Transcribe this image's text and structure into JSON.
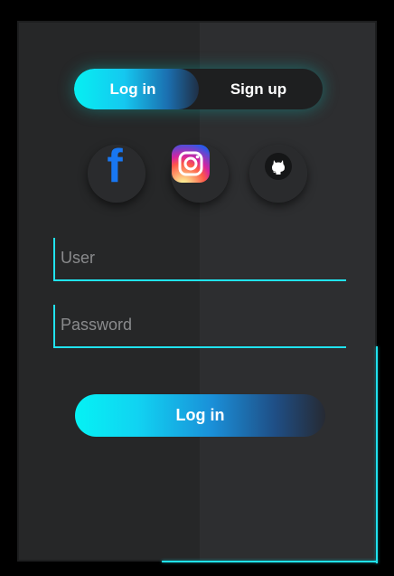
{
  "toggle": {
    "login_label": "Log in",
    "signup_label": "Sign up",
    "active": "login"
  },
  "social": [
    {
      "name": "facebook",
      "icon": "facebook-icon",
      "glyph": "f",
      "color": "#1877f2"
    },
    {
      "name": "instagram",
      "icon": "instagram-icon"
    },
    {
      "name": "github",
      "icon": "github-icon"
    }
  ],
  "form": {
    "user_placeholder": "User",
    "user_value": "",
    "password_placeholder": "Password",
    "password_value": "",
    "submit_label": "Log in"
  },
  "colors": {
    "accent": "#20e3ef",
    "background": "#262728",
    "text": "#ffffff"
  }
}
